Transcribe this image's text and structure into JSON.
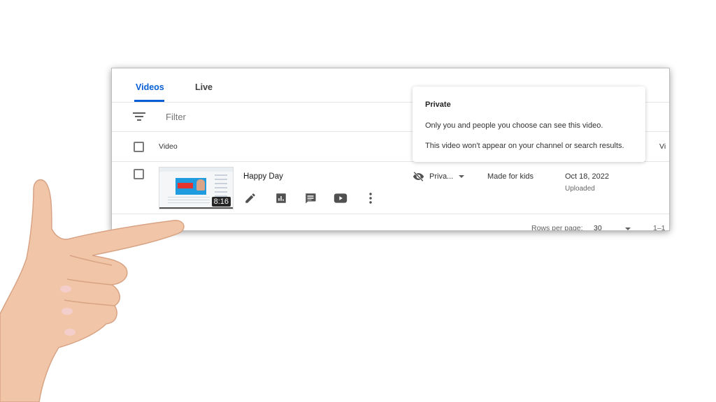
{
  "tabs": [
    {
      "label": "Videos",
      "active": true
    },
    {
      "label": "Live",
      "active": false
    }
  ],
  "filter": {
    "placeholder": "Filter"
  },
  "table": {
    "header_video": "Video",
    "header_views": "Vi"
  },
  "video": {
    "title": "Happy Day",
    "duration": "8:16",
    "visibility": "Priva...",
    "restrictions": "Made for kids",
    "date": "Oct 18, 2022",
    "date_status": "Uploaded",
    "actions": [
      "pencil-icon",
      "analytics-icon",
      "comments-icon",
      "youtube-icon",
      "more-vert-icon"
    ]
  },
  "pagination": {
    "rows_label": "Rows per page:",
    "rows_value": "30",
    "range": "1–1"
  },
  "tooltip": {
    "title": "Private",
    "line1": "Only you and people you choose can see this video.",
    "line2": "This video won't appear on your channel or search results."
  },
  "colors": {
    "accent": "#065fd4",
    "skin": "#f1c6a8"
  }
}
